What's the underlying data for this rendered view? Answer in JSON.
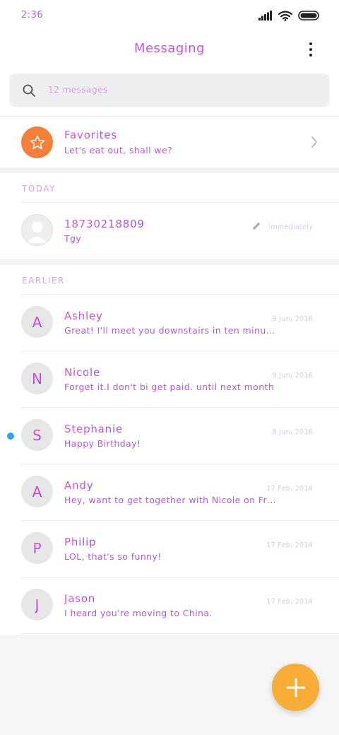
{
  "status_bar": {
    "time": "2:36"
  },
  "header": {
    "title": "Messaging",
    "search_placeholder": "12 messages"
  },
  "favorites": {
    "name": "Favorites",
    "snippet": "Let's eat out, shall we?"
  },
  "sections": {
    "today": {
      "label": "TODAY",
      "items": [
        {
          "name": "18730218809",
          "snippet": "Tgy",
          "date": "immediately"
        }
      ]
    },
    "earlier": {
      "label": "EARLIER",
      "items": [
        {
          "initial": "A",
          "name": "Ashley",
          "snippet": "Great! I'll meet you downstairs in ten minutes",
          "date": "9 Jun, 2016",
          "unread": false
        },
        {
          "initial": "N",
          "name": "Nicole",
          "snippet": "Forget it.I don't bi get paid. until next month",
          "date": "9 Jun, 2016",
          "unread": false
        },
        {
          "initial": "S",
          "name": "Stephanie",
          "snippet": "Happy Birthday!",
          "date": "8 Jun, 2016",
          "unread": true
        },
        {
          "initial": "A",
          "name": "Andy",
          "snippet": "Hey, want to get together with Nicole on Friday?",
          "date": "17 Feb, 2014",
          "unread": false
        },
        {
          "initial": "P",
          "name": "Philip",
          "snippet": "LOL, that's so funny!",
          "date": "17 Feb, 2014",
          "unread": false
        },
        {
          "initial": "J",
          "name": "Jason",
          "snippet": "I heard you're moving to China.",
          "date": "17 Feb, 2014",
          "unread": false
        }
      ]
    }
  },
  "colors": {
    "accent_gradient_start": "#ff4fc2",
    "accent_gradient_end": "#9a4cff",
    "favorites_avatar": "#f47f39",
    "fab": "#f8ad36",
    "unread_dot": "#2ea3f2"
  },
  "icons": {
    "signal": "signal-icon",
    "wifi": "wifi-icon",
    "battery": "battery-icon",
    "more": "more-vertical-icon",
    "search": "search-icon",
    "star": "star-icon",
    "chevron": "chevron-right-icon",
    "pencil": "pencil-icon",
    "person": "person-icon",
    "plus": "plus-icon"
  }
}
